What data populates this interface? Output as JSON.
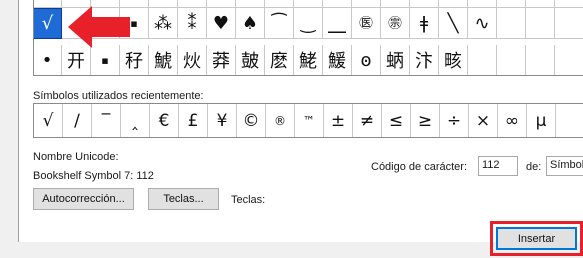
{
  "grid": {
    "row0": [
      "",
      "",
      "",
      "",
      "",
      "",
      "",
      "",
      "",
      "",
      "",
      "",
      "",
      "",
      "",
      "",
      "",
      "",
      ""
    ],
    "row1": [
      "√",
      "",
      "---",
      "▪",
      "⁂",
      "⁑",
      "♥",
      "♠",
      "⁀",
      "‿",
      "⎽",
      "㊩",
      "㊪",
      "ǂ",
      "╲",
      "∿",
      "",
      "",
      ""
    ],
    "row2": [
      "•",
      "开",
      "▪",
      "秄",
      "鯱",
      "炏",
      "莽",
      "皷",
      "麽",
      "鮱",
      "鰀",
      "ꙩ",
      "蛃",
      "汴",
      "畡",
      "",
      "",
      "",
      ""
    ]
  },
  "recent_label": "Símbolos utilizados recientemente:",
  "recent_symbols": [
    "√",
    "∕",
    "‾",
    "‸",
    "€",
    "£",
    "¥",
    "©",
    "®",
    "™",
    "±",
    "≠",
    "≤",
    "≥",
    "÷",
    "×",
    "∞",
    "µ"
  ],
  "unicode_name_label": "Nombre Unicode:",
  "unicode_name_value": "Bookshelf Symbol 7: 112",
  "code_label": "Código de carácter:",
  "code_value": "112",
  "from_label": "de:",
  "from_value": "Símbolo",
  "autocorrect_button": "Autocorrección...",
  "keys_button": "Teclas...",
  "keys_label": "Teclas:",
  "insert_button": "Insertar",
  "colors": {
    "selection": "#1f6bd6",
    "arrow": "#e8202a",
    "highlight": "#e8202a"
  }
}
